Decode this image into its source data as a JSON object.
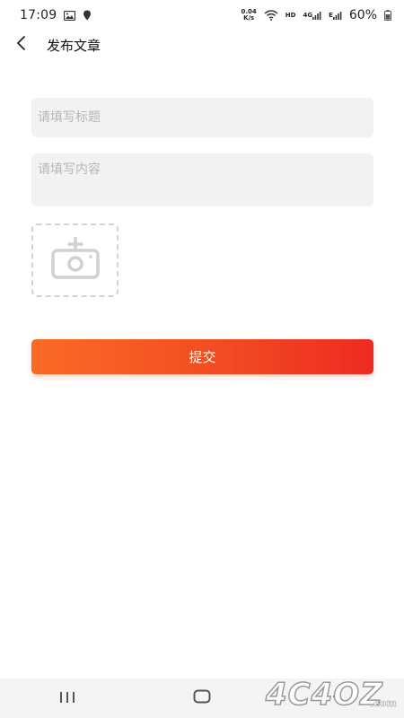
{
  "status_bar": {
    "time": "17:09",
    "net_speed_value": "0.04",
    "net_speed_unit": "K/s",
    "hd_label": "HD",
    "network_label_1": "4G",
    "network_label_2": "E",
    "battery": "60%"
  },
  "header": {
    "title": "发布文章"
  },
  "form": {
    "title_placeholder": "请填写标题",
    "title_value": "",
    "content_placeholder": "请填写内容",
    "content_value": "",
    "submit_label": "提交"
  },
  "watermark": {
    "text": "4C4OZ",
    "suffix": ".com"
  },
  "colors": {
    "accent_start": "#fb6a25",
    "accent_end": "#ee2a21",
    "input_bg": "#f2f2f2",
    "placeholder": "#b7b7b7"
  }
}
